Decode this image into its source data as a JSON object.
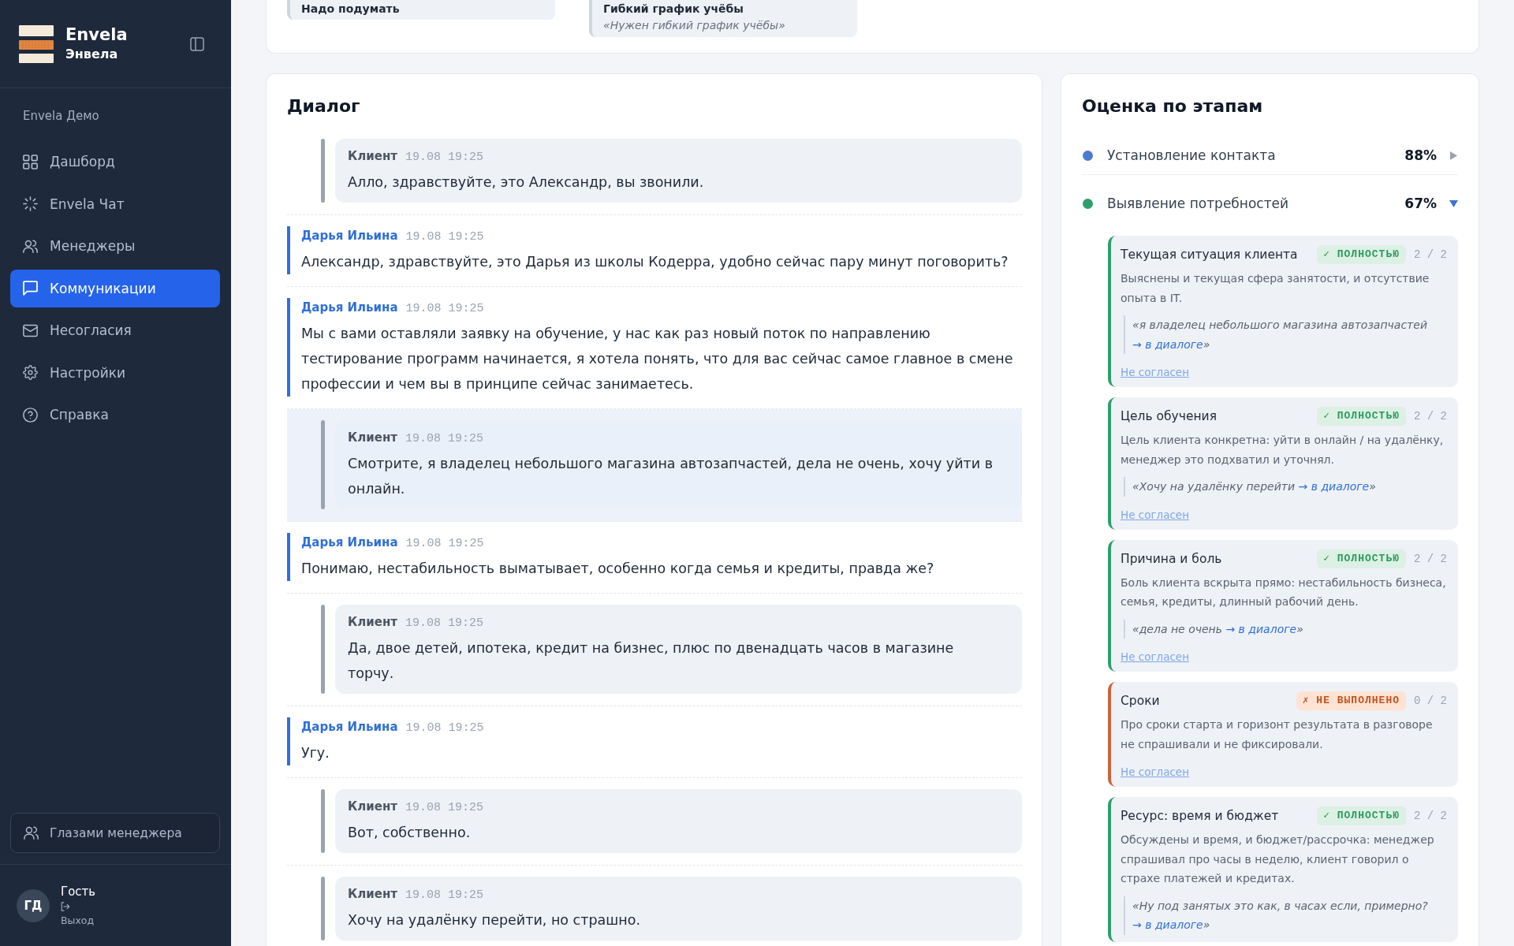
{
  "sidebar": {
    "brand": {
      "name": "Envela",
      "subtitle": "Энвела"
    },
    "workspace": "Envela Демо",
    "items": [
      {
        "label": "Дашборд",
        "selected": false
      },
      {
        "label": "Envela Чат",
        "selected": false
      },
      {
        "label": "Менеджеры",
        "selected": false
      },
      {
        "label": "Коммуникации",
        "selected": true
      },
      {
        "label": "Несогласия",
        "selected": false
      },
      {
        "label": "Настройки",
        "selected": false
      },
      {
        "label": "Справка",
        "selected": false
      }
    ],
    "view_as_button": "Глазами менеджера",
    "user": {
      "initials": "ГД",
      "name": "Гость",
      "logout": "Выход"
    }
  },
  "summary_panel": {
    "items": [
      {
        "title": "Надо подумать"
      },
      {
        "title": "Гибкий график учёбы",
        "quote": "«Нужен гибкий график учёбы»"
      }
    ]
  },
  "dialog": {
    "title": "Диалог",
    "messages": [
      {
        "kind": "client",
        "speaker": "Клиент",
        "time": "19.08 19:25",
        "text": "Алло, здравствуйте, это Александр, вы звонили.",
        "highlighted": false
      },
      {
        "kind": "manager",
        "speaker": "Дарья Ильина",
        "time": "19.08 19:25",
        "text": "Александр, здравствуйте, это Дарья из школы Кодерра, удобно сейчас пару минут поговорить?",
        "highlighted": false
      },
      {
        "kind": "manager",
        "speaker": "Дарья Ильина",
        "time": "19.08 19:25",
        "text": "Мы с вами оставляли заявку на обучение, у нас как раз новый поток по направлению тестирование программ начинается, я хотела понять, что для вас сейчас самое главное в смене профессии и чем вы в принципе сейчас занимаетесь.",
        "highlighted": false
      },
      {
        "kind": "client",
        "speaker": "Клиент",
        "time": "19.08 19:25",
        "text": "Смотрите, я владелец небольшого магазина автозапчастей, дела не очень, хочу уйти в онлайн.",
        "highlighted": true
      },
      {
        "kind": "manager",
        "speaker": "Дарья Ильина",
        "time": "19.08 19:25",
        "text": "Понимаю, нестабильность выматывает, особенно когда семья и кредиты, правда же?",
        "highlighted": false
      },
      {
        "kind": "client",
        "speaker": "Клиент",
        "time": "19.08 19:25",
        "text": "Да, двое детей, ипотека, кредит на бизнес, плюс по двенадцать часов в магазине торчу.",
        "highlighted": false
      },
      {
        "kind": "manager",
        "speaker": "Дарья Ильина",
        "time": "19.08 19:25",
        "text": "Угу.",
        "highlighted": false
      },
      {
        "kind": "client",
        "speaker": "Клиент",
        "time": "19.08 19:25",
        "text": "Вот, собственно.",
        "highlighted": false
      },
      {
        "kind": "client",
        "speaker": "Клиент",
        "time": "19.08 19:25",
        "text": "Хочу на удалёнку перейти, но страшно.",
        "highlighted": false
      }
    ]
  },
  "stages": {
    "title": "Оценка по этапам",
    "items": [
      {
        "name": "Установление контакта",
        "score": "88%",
        "color": "#4a7bd0",
        "expanded": false
      },
      {
        "name": "Выявление потребностей",
        "score": "67%",
        "color": "#2e9e6e",
        "expanded": true,
        "criteria": [
          {
            "title": "Текущая ситуация клиента",
            "kind": "passed",
            "badge": "✓ ПОЛНОСТЬЮ",
            "count": "2 / 2",
            "description": "Выяснены и текущая сфера занятости, и отсутствие опыта в IT.",
            "quote": "«я владелец небольшого магазина автозапчастей",
            "link": "→ в диалоге",
            "quote_end": "»",
            "disagree": "Не согласен"
          },
          {
            "title": "Цель обучения",
            "kind": "passed",
            "badge": "✓ ПОЛНОСТЬЮ",
            "count": "2 / 2",
            "description": "Цель клиента конкретна: уйти в онлайн / на удалёнку, менеджер это подхватил и уточнял.",
            "quote": "«Хочу на удалёнку перейти",
            "link": "→ в диалоге",
            "quote_end": "»",
            "disagree": "Не согласен"
          },
          {
            "title": "Причина и боль",
            "kind": "passed",
            "badge": "✓ ПОЛНОСТЬЮ",
            "count": "2 / 2",
            "description": "Боль клиента вскрыта прямо: нестабильность бизнеса, семья, кредиты, длинный рабочий день.",
            "quote": "«дела не очень",
            "link": "→ в диалоге",
            "quote_end": "»",
            "disagree": "Не согласен"
          },
          {
            "title": "Сроки",
            "kind": "missed",
            "badge": "✗ НЕ ВЫПОЛНЕНО",
            "count": "0 / 2",
            "description": "Про сроки старта и горизонт результата в разговоре не спрашивали и не фиксировали.",
            "disagree": "Не согласен"
          },
          {
            "title": "Ресурс: время и бюджет",
            "kind": "passed",
            "badge": "✓ ПОЛНОСТЬЮ",
            "count": "2 / 2",
            "description": "Обсуждены и время, и бюджет/рассрочка: менеджер спрашивал про часы в неделю, клиент говорил о страхе платежей и кредитах.",
            "quote": "«Ну под занятых это как, в часах если, примерно?",
            "link": "→ в диалоге",
            "quote_end": "»"
          }
        ]
      }
    ]
  }
}
